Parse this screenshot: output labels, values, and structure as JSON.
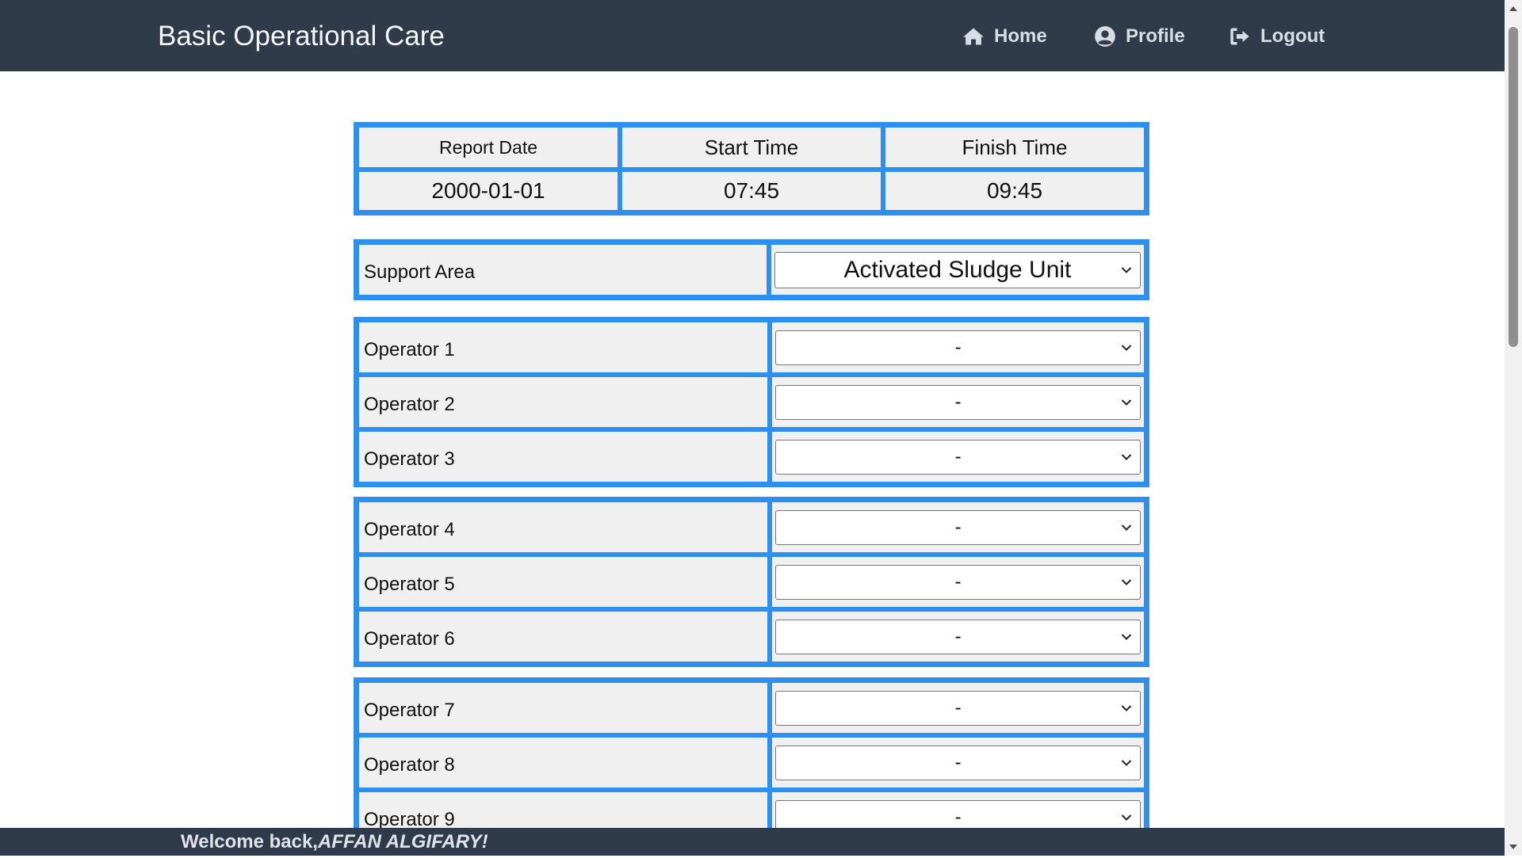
{
  "navbar": {
    "brand": "Basic Operational Care",
    "home_label": "Home",
    "profile_label": "Profile",
    "logout_label": "Logout"
  },
  "report": {
    "headers": [
      "Report Date",
      "Start Time",
      "Finish Time"
    ],
    "values": [
      "2000-01-01",
      "07:45",
      "09:45"
    ]
  },
  "support_area": {
    "label": "Support Area",
    "selected": "Activated Sludge Unit"
  },
  "operators": [
    {
      "label": "Operator 1",
      "selected": "-"
    },
    {
      "label": "Operator 2",
      "selected": "-"
    },
    {
      "label": "Operator 3",
      "selected": "-"
    },
    {
      "label": "Operator 4",
      "selected": "-"
    },
    {
      "label": "Operator 5",
      "selected": "-"
    },
    {
      "label": "Operator 6",
      "selected": "-"
    },
    {
      "label": "Operator 7",
      "selected": "-"
    },
    {
      "label": "Operator 8",
      "selected": "-"
    },
    {
      "label": "Operator 9",
      "selected": "-"
    }
  ],
  "footer": {
    "welcome": "Welcome back,",
    "user": "AFFAN ALGIFARY!"
  },
  "colors": {
    "navbar": "#2f3a4a",
    "accent_border": "#2f8fef",
    "cell_bg": "#f0f0f0"
  }
}
